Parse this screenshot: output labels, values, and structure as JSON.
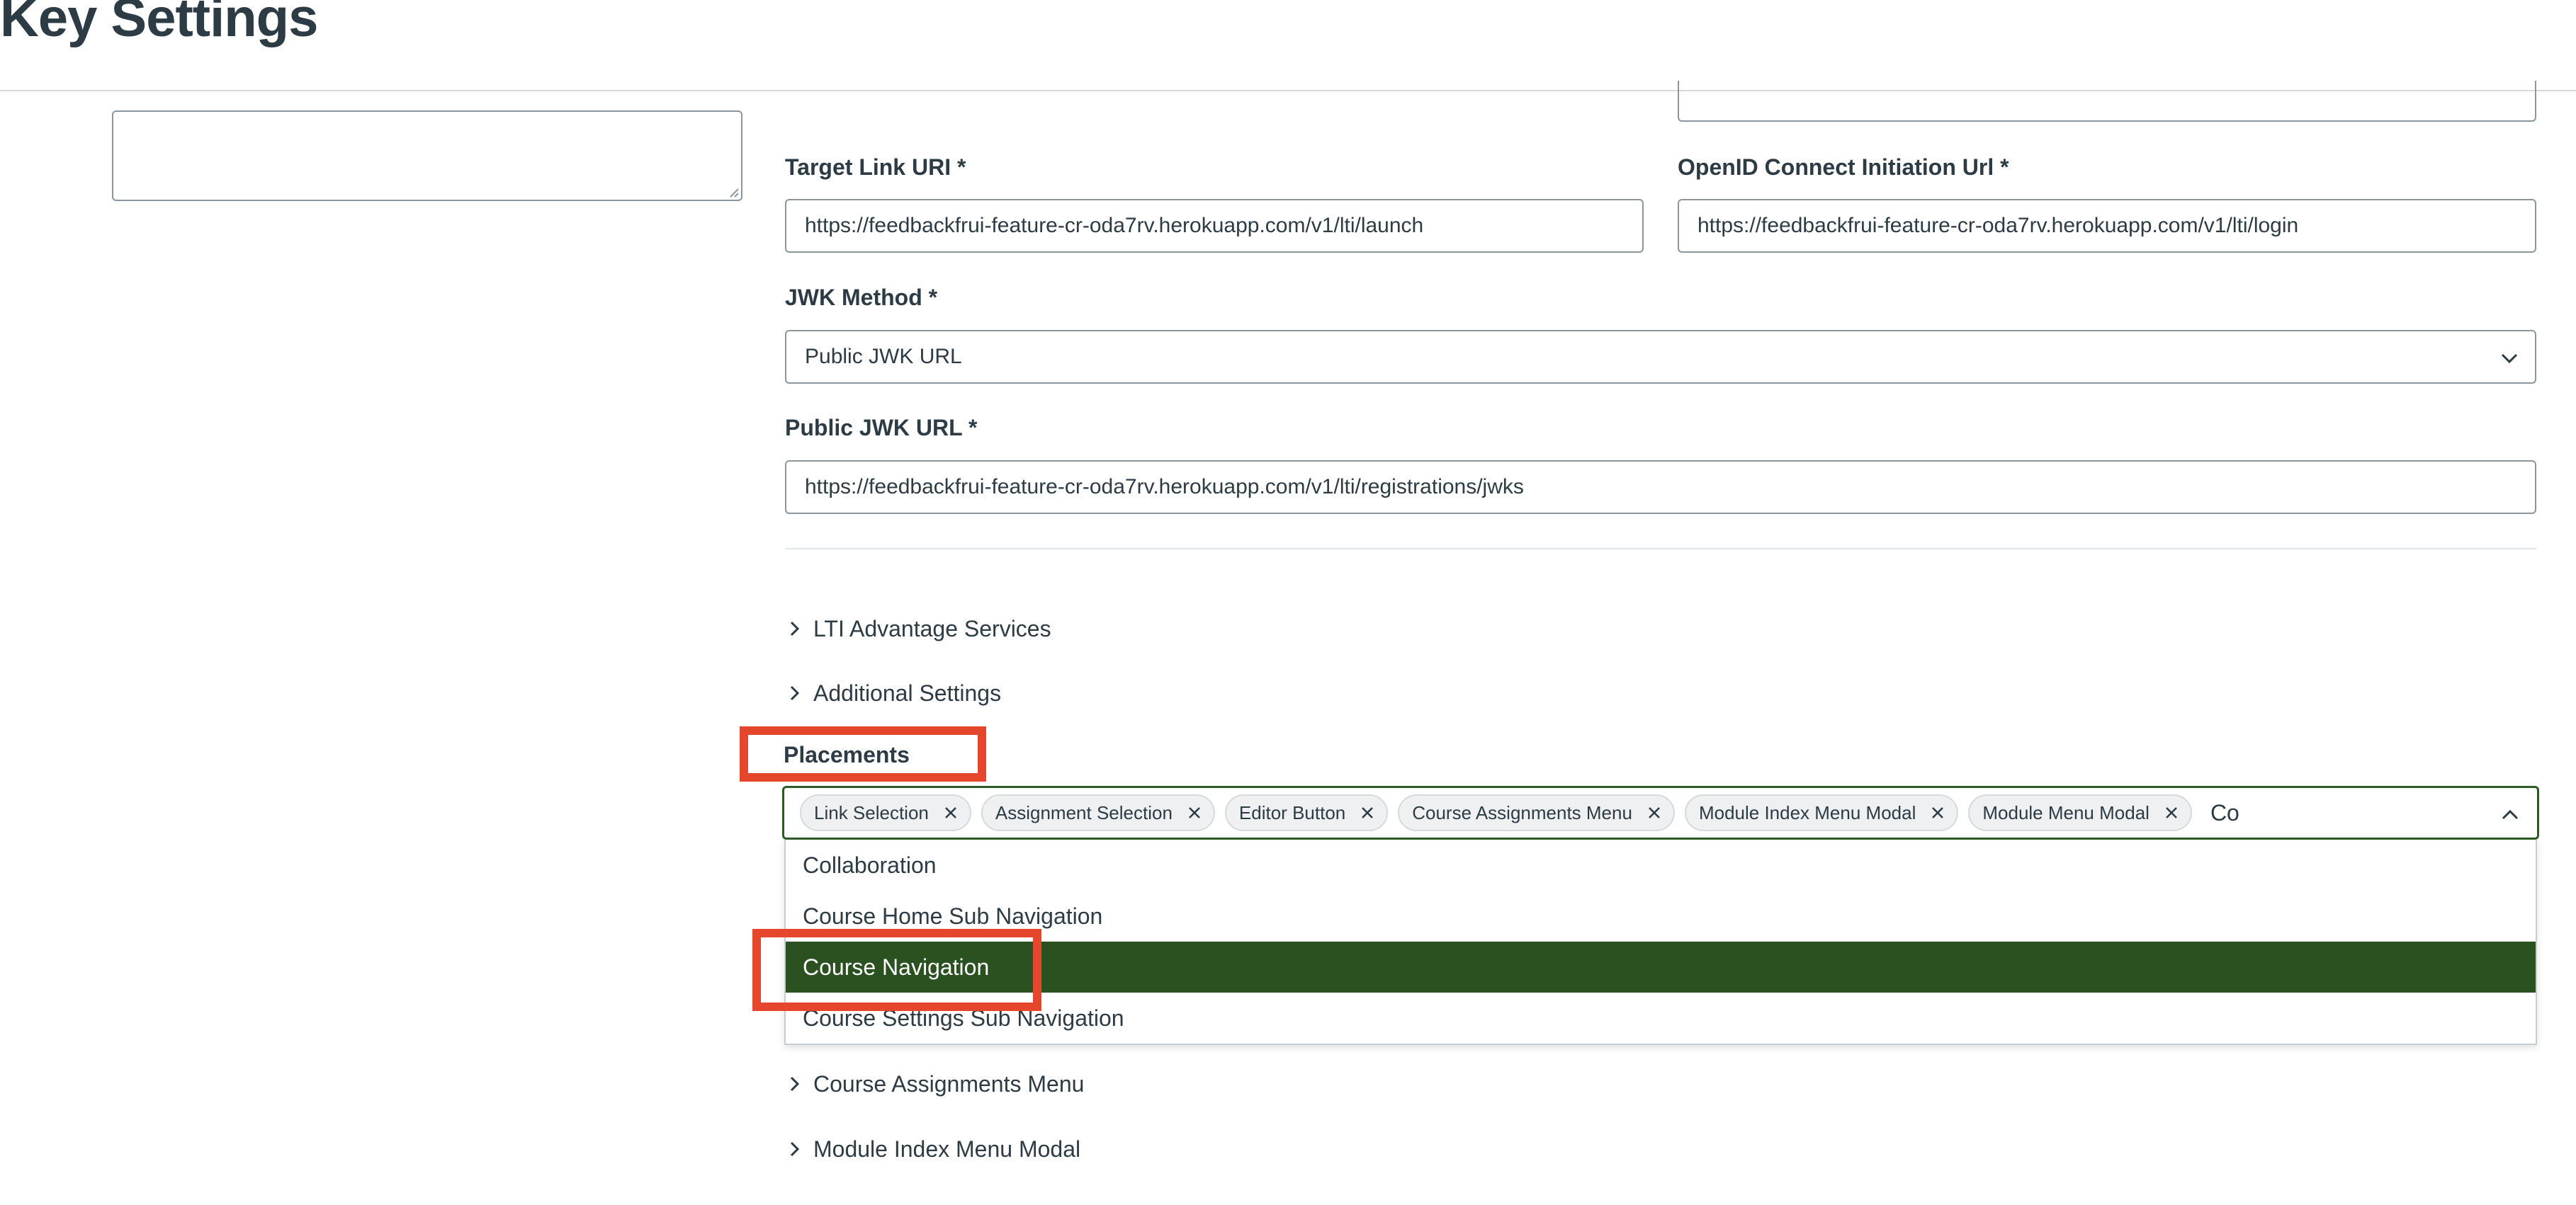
{
  "header": {
    "title": "Key Settings"
  },
  "form": {
    "target_link_uri": {
      "label": "Target Link URI *",
      "value": "https://feedbackfrui-feature-cr-oda7rv.herokuapp.com/v1/lti/launch"
    },
    "openid_url": {
      "label": "OpenID Connect Initiation Url *",
      "value": "https://feedbackfrui-feature-cr-oda7rv.herokuapp.com/v1/lti/login"
    },
    "jwk_method": {
      "label": "JWK Method *",
      "value": "Public JWK URL"
    },
    "public_jwk_url": {
      "label": "Public JWK URL *",
      "value": "https://feedbackfrui-feature-cr-oda7rv.herokuapp.com/v1/lti/registrations/jwks"
    }
  },
  "sections": {
    "lti_advantage": "LTI Advantage Services",
    "additional": "Additional Settings",
    "course_assignments_menu": "Course Assignments Menu",
    "module_index_menu_modal": "Module Index Menu Modal"
  },
  "placements": {
    "label": "Placements",
    "chips": [
      "Link Selection",
      "Assignment Selection",
      "Editor Button",
      "Course Assignments Menu",
      "Module Index Menu Modal",
      "Module Menu Modal"
    ],
    "input_value": "Co",
    "options": [
      "Collaboration",
      "Course Home Sub Navigation",
      "Course Navigation",
      "Course Settings Sub Navigation"
    ],
    "selected_option": "Course Navigation"
  },
  "icons": {
    "chip_remove": "close-icon",
    "collapsed_section": "chevron-right-icon",
    "select_open": "chevron-down-icon",
    "combo_open": "chevron-up-icon"
  },
  "colors": {
    "accent": "#2b5121",
    "highlight": "#e5462c",
    "text": "#2d3b45"
  }
}
